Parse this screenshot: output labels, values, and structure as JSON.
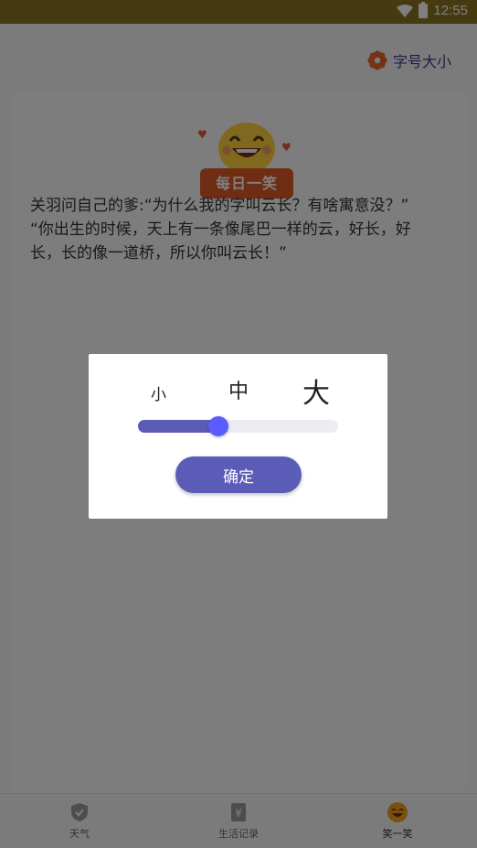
{
  "status_bar": {
    "time": "12:55",
    "wifi_icon": "wifi-icon",
    "battery_icon": "battery-icon"
  },
  "header": {
    "font_size_label": "字号大小",
    "font_size_icon": "flower-icon"
  },
  "badge": {
    "label": "每日一笑",
    "icon": "smiley-face-icon"
  },
  "joke": {
    "text": "关羽问自己的爹:“为什么我的字叫云长？有啥寓意没？”\n“你出生的时候，天上有一条像尾巴一样的云，好长，好长，长的像一道桥，所以你叫云长！”"
  },
  "tabs": [
    {
      "label": "天气",
      "icon": "shield-icon",
      "active": false
    },
    {
      "label": "生活记录",
      "icon": "yuan-document-icon",
      "active": false
    },
    {
      "label": "笑一笑",
      "icon": "smiley-icon",
      "active": true
    }
  ],
  "dialog": {
    "size_small": "小",
    "size_medium": "中",
    "size_large": "大",
    "slider_value": 0.4,
    "confirm_label": "确定"
  },
  "colors": {
    "accent": "#5a5cb8",
    "badge": "#df5a28",
    "status_bar": "#8a7420"
  }
}
